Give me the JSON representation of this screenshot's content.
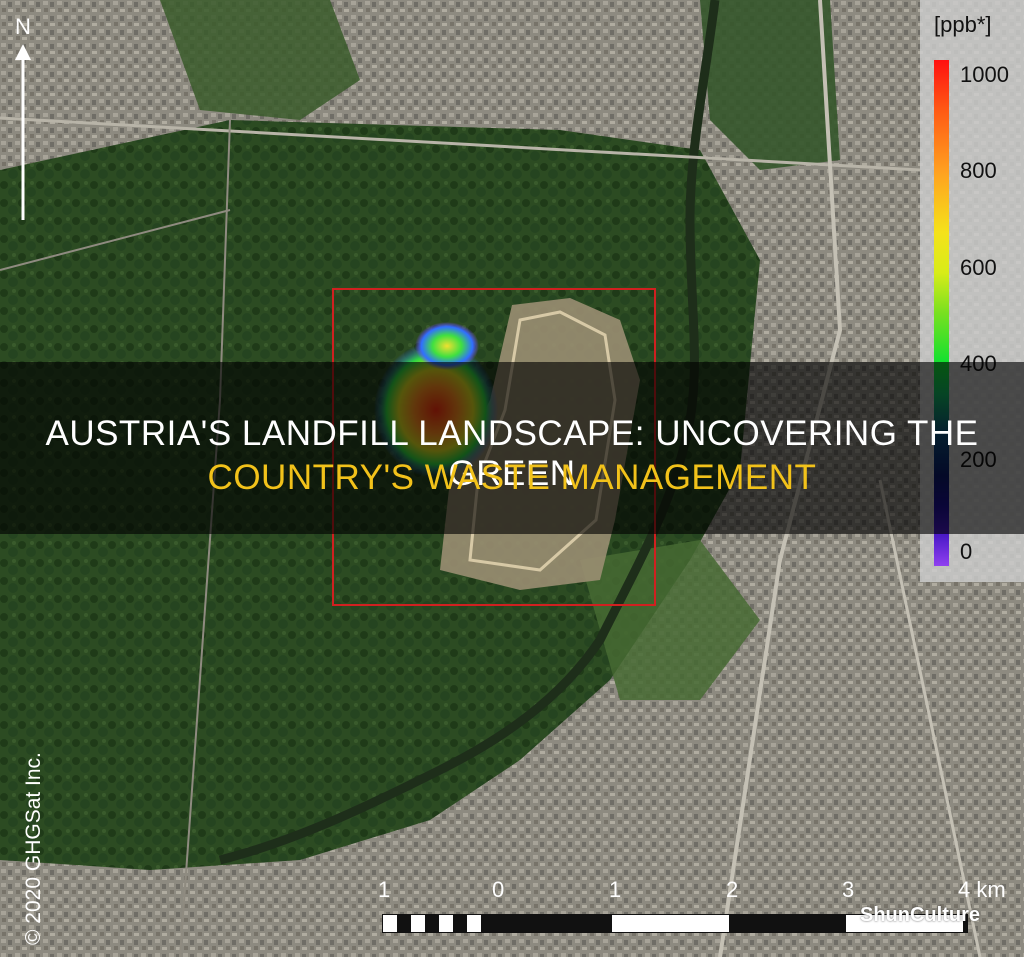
{
  "north_label": "N",
  "legend": {
    "unit": "[ppb*]",
    "ticks": [
      "1000",
      "800",
      "600",
      "400",
      "200",
      "0"
    ],
    "colors": [
      "#ff1010",
      "#ffa020",
      "#f5e21a",
      "#10e030",
      "#0c1a66",
      "#9040f0"
    ]
  },
  "scale": {
    "labels": [
      "1",
      "0",
      "1",
      "2",
      "3",
      "4 km"
    ]
  },
  "copyright": "© 2020 GHGSat Inc.",
  "watermark": "ShunCulture",
  "title": {
    "line1": "AUSTRIA'S LANDFILL LANDSCAPE: UNCOVERING THE GREEN",
    "line2": "COUNTRY'S WASTE MANAGEMENT"
  },
  "colors": {
    "title_primary": "#ffffff",
    "title_accent": "#f2c21a",
    "highlight_box": "#d02020"
  },
  "icons": {
    "north": "north-arrow-icon"
  }
}
